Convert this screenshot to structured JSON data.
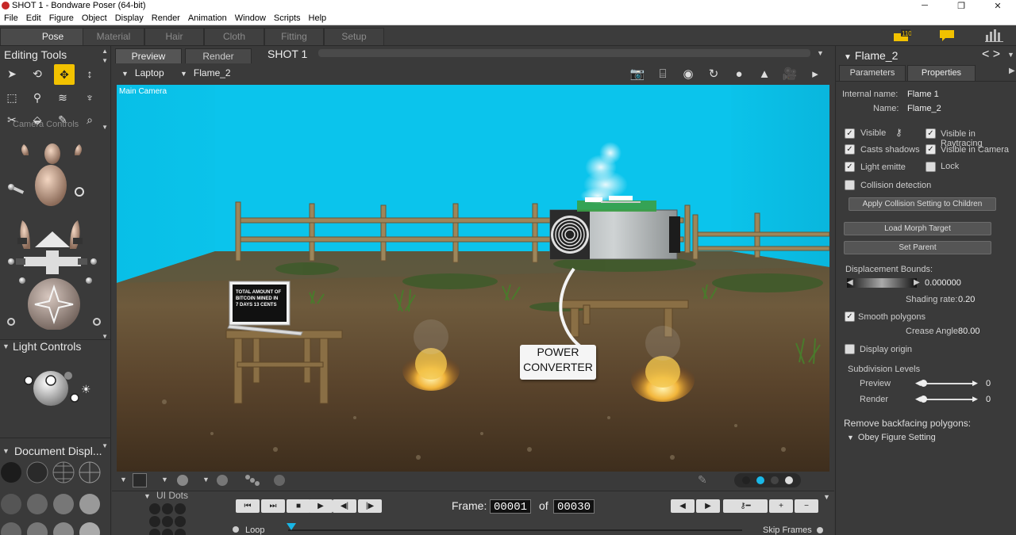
{
  "window": {
    "title": "SHOT 1 - Bondware Poser (64-bit)"
  },
  "menu": [
    "File",
    "Edit",
    "Figure",
    "Object",
    "Display",
    "Render",
    "Animation",
    "Window",
    "Scripts",
    "Help"
  ],
  "rooms": [
    "Pose",
    "Material",
    "Hair",
    "Cloth",
    "Fitting",
    "Setup"
  ],
  "badge_count": "110",
  "left": {
    "editing_tools": "Editing Tools",
    "camera_controls": "Camera Controls",
    "light_controls": "Light Controls",
    "document_display": "Document Displ...",
    "ui_dots": "UI Dots"
  },
  "viewport": {
    "tabs": [
      "Preview",
      "Render"
    ],
    "shot": "SHOT 1",
    "figure_select": "Laptop",
    "actor_select": "Flame_2",
    "camera_label": "Main Camera",
    "laptop_text": [
      "TOTAL AMOUNT OF",
      "BITCOIN MINED IN",
      "7 DAYS    13 CENTS"
    ],
    "power_converter": [
      "POWER",
      "CONVERTER"
    ]
  },
  "timeline": {
    "frame_label": "Frame:",
    "frame_current": "00001",
    "of_label": "of",
    "frame_total": "00030",
    "loop": "Loop",
    "skip": "Skip Frames"
  },
  "right": {
    "title": "Flame_2",
    "tabs": [
      "Parameters",
      "Properties"
    ],
    "internal_name_label": "Internal name:",
    "internal_name": "Flame 1",
    "name_label": "Name:",
    "name": "Flame_2",
    "checks": {
      "visible": "Visible",
      "visible_raytracing": "Visible in Raytracing",
      "casts_shadows": "Casts shadows",
      "visible_camera": "Visible in Camera",
      "light_emitte": "Light emitte",
      "lock": "Lock",
      "collision": "Collision detection"
    },
    "apply_collision": "Apply Collision Setting to Children",
    "load_morph": "Load Morph Target",
    "set_parent": "Set Parent",
    "displacement_label": "Displacement Bounds:",
    "displacement_value": "0.000000",
    "shading_label": "Shading rate:",
    "shading_value": "0.20",
    "smooth_polygons": "Smooth polygons",
    "crease_label": "Crease Angle",
    "crease_value": "80.00",
    "display_origin": "Display origin",
    "subdivision_label": "Subdivision Levels",
    "preview_label": "Preview",
    "preview_value": "0",
    "render_label": "Render",
    "render_value": "0",
    "remove_backfacing": "Remove backfacing polygons:",
    "obey_figure": "Obey Figure Setting"
  }
}
